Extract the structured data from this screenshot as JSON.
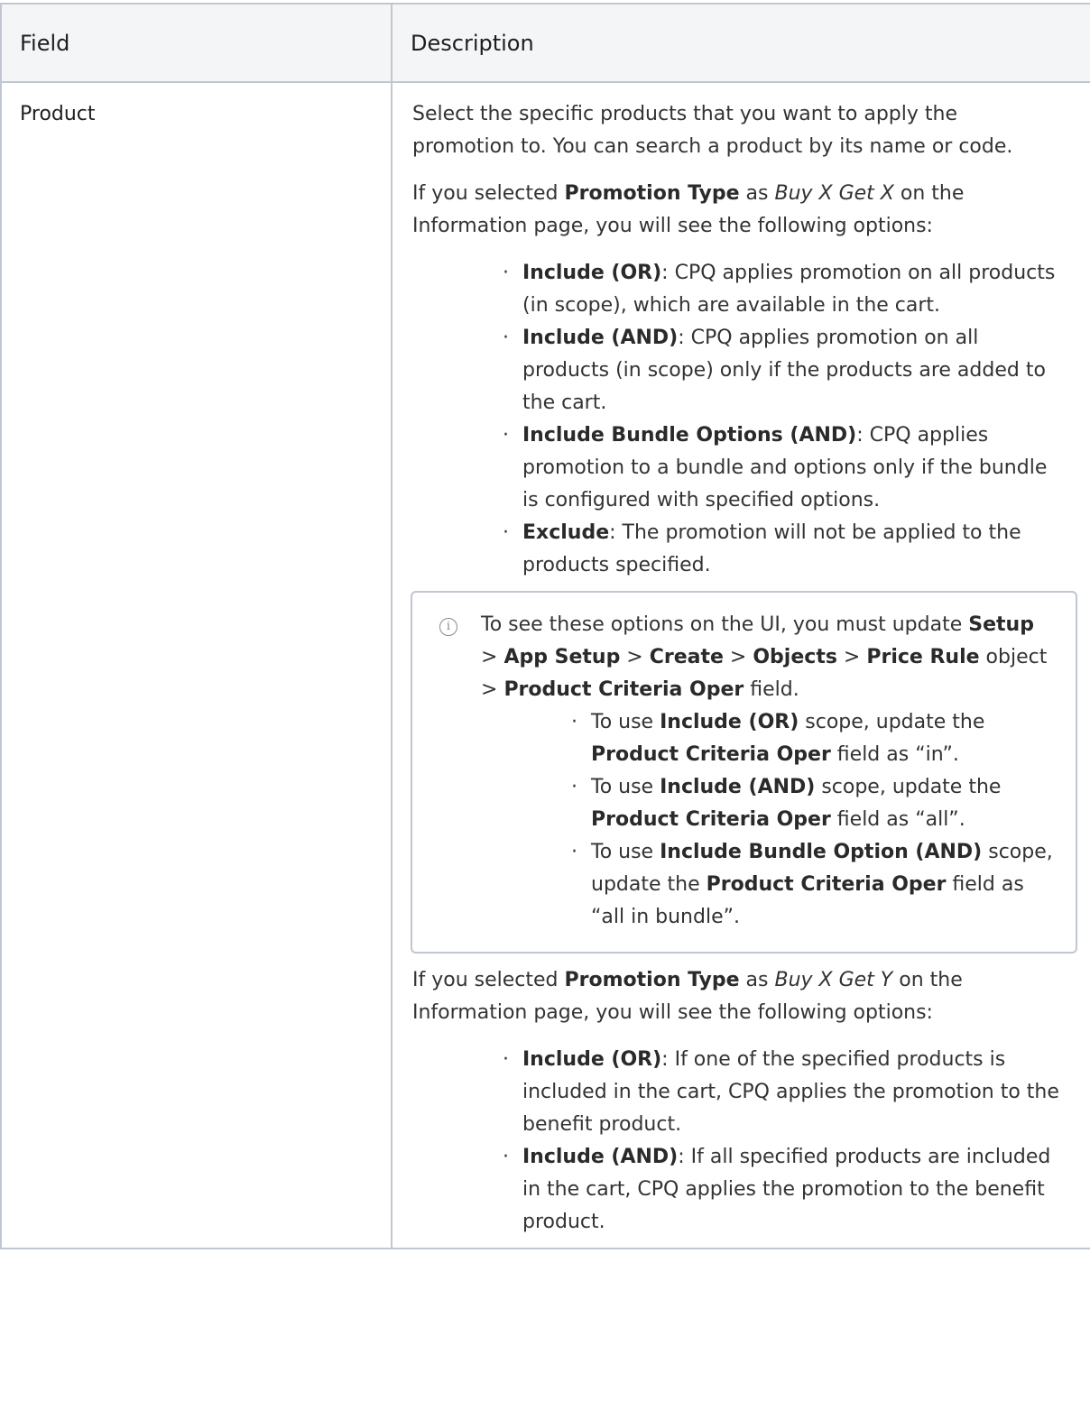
{
  "table": {
    "headers": [
      "Field",
      "Description"
    ],
    "row": {
      "field": "Product",
      "intro": "Select the specific products that you want to apply the promotion to. You can search a product by its name or code.",
      "buy_x_get_x": {
        "pre": "If you selected ",
        "bold": "Promotion Type",
        "mid": " as ",
        "italic": "Buy X Get X",
        "post": " on the Information page, you will see the following options:",
        "options": [
          {
            "label": "Include (OR)",
            "text": ": CPQ applies promotion on all products (in scope), which are available in the cart."
          },
          {
            "label": "Include (AND)",
            "text": ": CPQ applies promotion on all products (in scope) only if the products are added to the cart."
          },
          {
            "label": "Include Bundle Options (AND)",
            "text": ": CPQ applies promotion to a bundle and options only if the bundle is configured with specified options."
          },
          {
            "label": "Exclude",
            "text": ": The promotion will not be applied to the products specified."
          }
        ]
      },
      "note": {
        "icon": "info-icon",
        "t1": "To see these options on the UI, you must update ",
        "b1": "Setup",
        "sep": " > ",
        "b2": "App Setup",
        "b3": "Create",
        "b4": "Objects",
        "b5": "Price Rule",
        "t2": " object > ",
        "b6": "Product Criteria Oper",
        "t3": " field.",
        "items": [
          {
            "pre": "To use ",
            "scope": "Include (OR)",
            "mid": " scope, update the ",
            "field": "Product Criteria Oper",
            "post": " field as “in”."
          },
          {
            "pre": "To use ",
            "scope": "Include (AND)",
            "mid": " scope, update the ",
            "field": "Product Criteria Oper",
            "post": " field as “all”."
          },
          {
            "pre": "To use ",
            "scope": "Include Bundle Option (AND)",
            "mid": " scope, update the ",
            "field": "Product Criteria Oper",
            "post": " field as “all in bundle”."
          }
        ]
      },
      "buy_x_get_y": {
        "pre": "If you selected ",
        "bold": "Promotion Type",
        "mid": " as ",
        "italic": "Buy X Get Y",
        "post": " on the Information page, you will see the following options:",
        "options": [
          {
            "label": "Include (OR)",
            "text": ": If one of the specified products is included in the cart, CPQ applies the promotion to the benefit product."
          },
          {
            "label": "Include (AND)",
            "text": ": If all specified products are included in the cart, CPQ applies the promotion to the benefit product."
          }
        ]
      }
    }
  }
}
